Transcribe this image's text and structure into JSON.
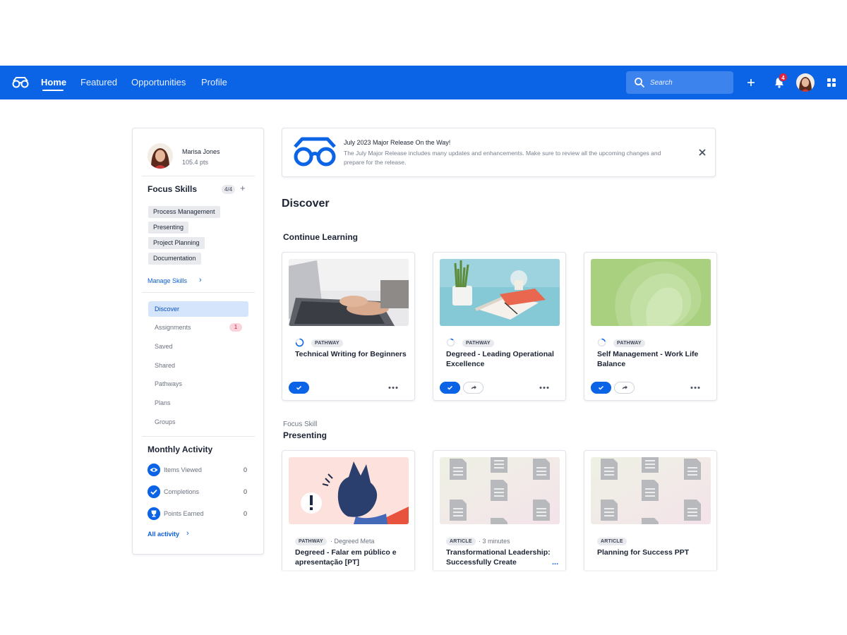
{
  "nav": {
    "links": [
      "Home",
      "Featured",
      "Opportunities",
      "Profile"
    ],
    "search_placeholder": "Search",
    "notification_count": "4",
    "brand_color": "#0b63e5"
  },
  "profile": {
    "name": "Marisa Jones",
    "points": "105.4 pts"
  },
  "focus_skills": {
    "title": "Focus Skills",
    "count": "4/4",
    "add": "+",
    "skills": [
      "Process Management",
      "Presenting",
      "Project Planning",
      "Documentation"
    ],
    "manage_label": "Manage Skills",
    "chevron": "›"
  },
  "menu": {
    "items": [
      "Discover",
      "Assignments",
      "Saved",
      "Shared",
      "Pathways",
      "Plans",
      "Groups"
    ],
    "active": "Discover",
    "assignments_count": "1"
  },
  "monthly_activity": {
    "title": "Monthly Activity",
    "rows": [
      {
        "label": "Items Viewed",
        "value": "0",
        "icon": "eye-icon"
      },
      {
        "label": "Completions",
        "value": "0",
        "icon": "check-icon"
      },
      {
        "label": "Points Earned",
        "value": "0",
        "icon": "trophy-icon"
      }
    ],
    "all_label": "All activity",
    "chevron": "›"
  },
  "banner": {
    "title": "July 2023 Major Release On the Way!",
    "text": "The July Major Release includes many updates and enhancements. Make sure to review all the upcoming changes and prepare for the release."
  },
  "main": {
    "heading": "Discover",
    "continue_heading": "Continue Learning",
    "focus_skill_label": "Focus Skill",
    "focus_skill_name": "Presenting"
  },
  "continue_cards": [
    {
      "type": "PATHWAY",
      "title": "Technical Writing for Beginners"
    },
    {
      "type": "PATHWAY",
      "title": "Degreed - Leading Operational Excellence"
    },
    {
      "type": "PATHWAY",
      "title": "Self Management - Work Life Balance"
    }
  ],
  "presenting_cards": [
    {
      "type": "PATHWAY",
      "meta": "· Degreed Meta",
      "title": "Degreed - Falar em público e apresentação [PT]"
    },
    {
      "type": "ARTICLE",
      "meta": "· 3 minutes",
      "title": "Transformational Leadership: Successfully Create",
      "more": "..."
    },
    {
      "type": "ARTICLE",
      "meta": "",
      "title": "Planning for Success PPT"
    }
  ]
}
